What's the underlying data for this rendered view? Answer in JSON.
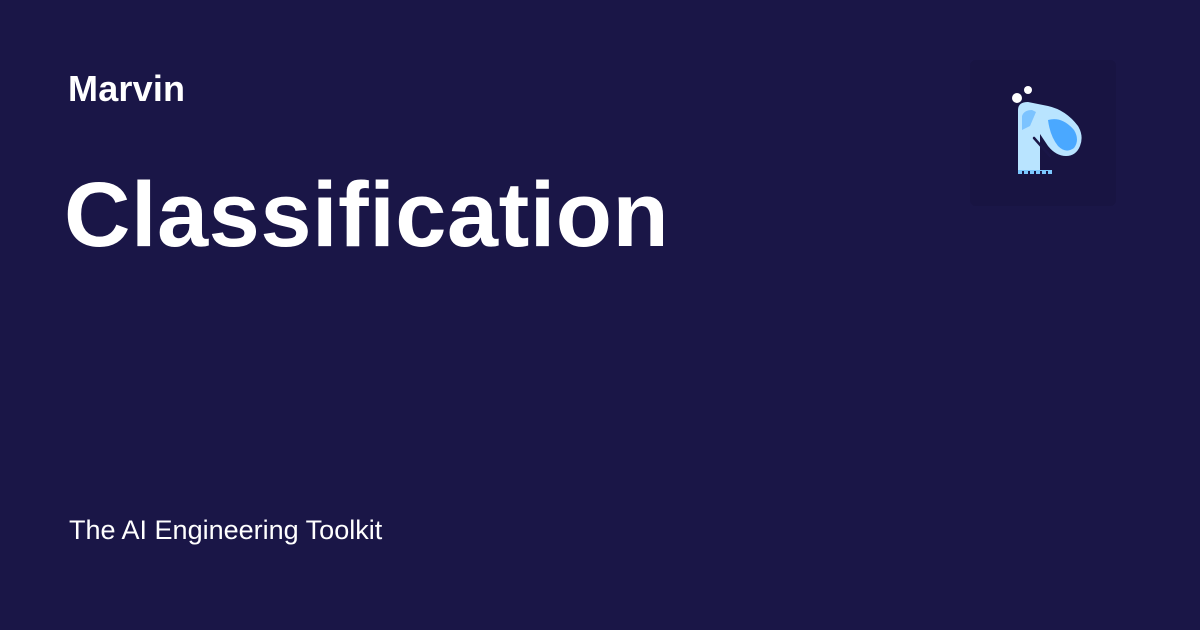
{
  "card": {
    "site_name": "Marvin",
    "title": "Classification",
    "tagline": "The AI Engineering Toolkit"
  },
  "logo": {
    "icon": "marvin-logo-icon"
  },
  "colors": {
    "background": "#1a1647",
    "text": "#ffffff",
    "logo_light": "#b9e4ff",
    "logo_accent": "#4aa8ff"
  }
}
